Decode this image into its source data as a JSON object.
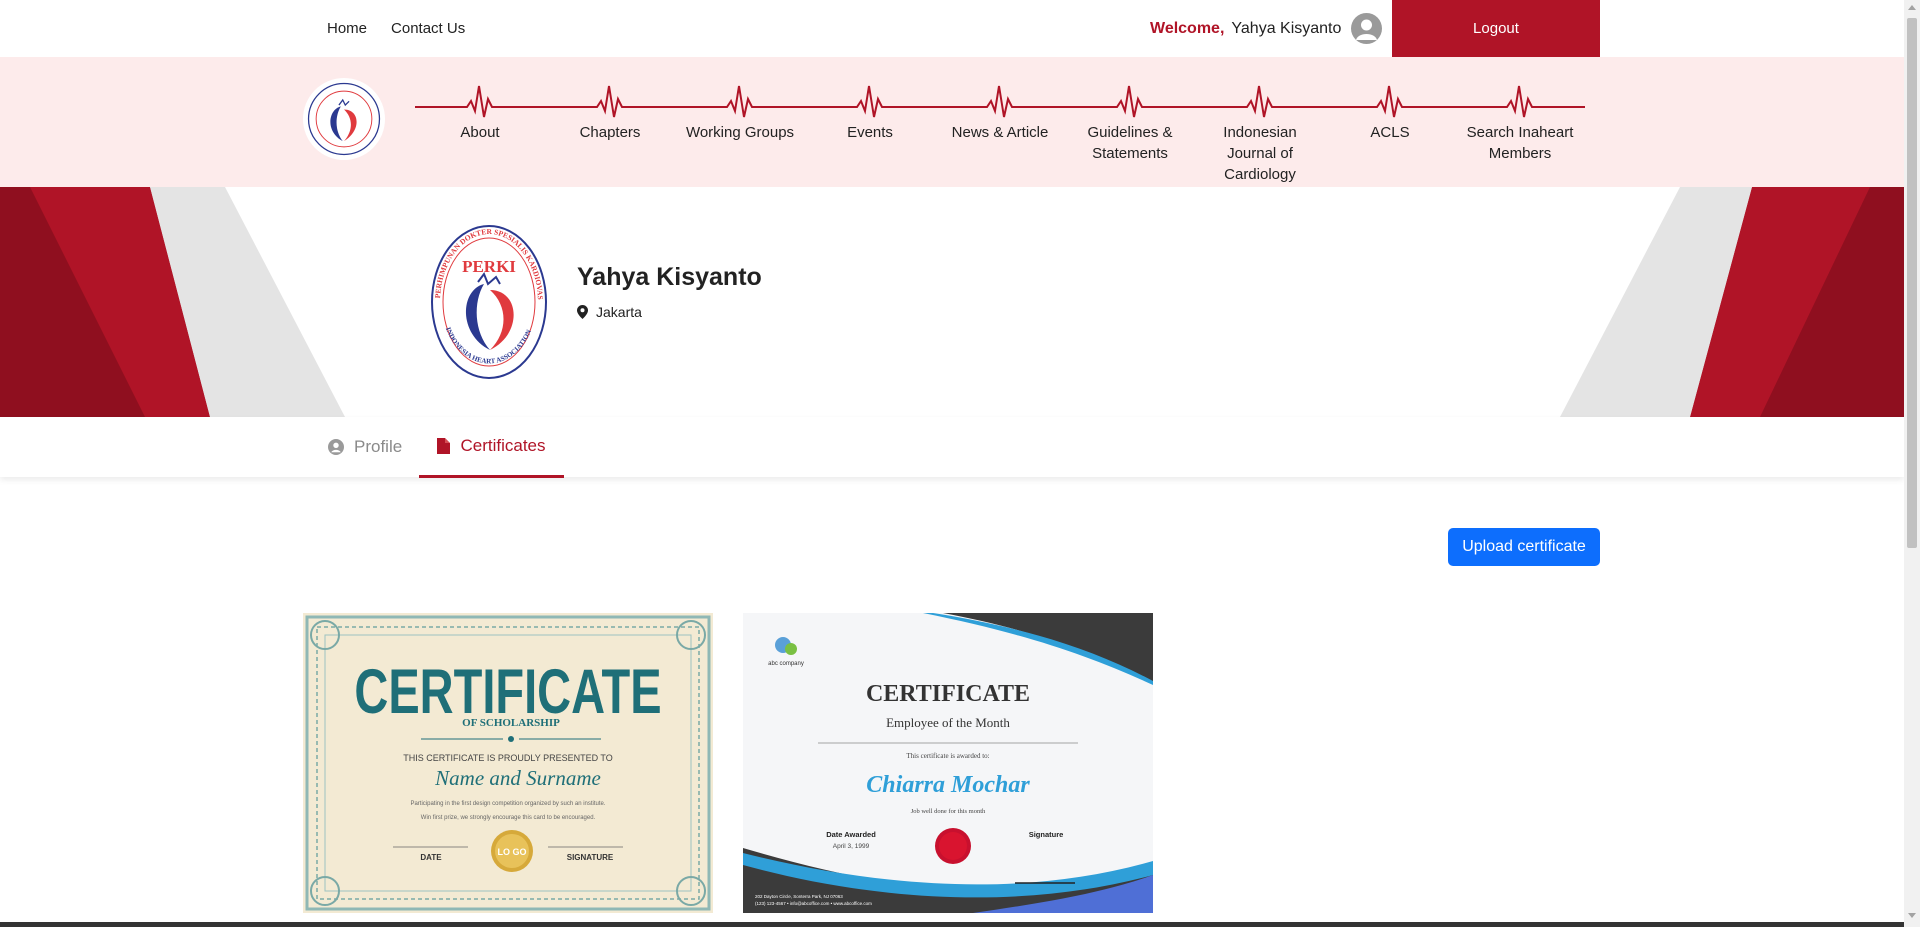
{
  "topbar": {
    "links": [
      "Home",
      "Contact Us"
    ],
    "welcome_label": "Welcome,",
    "user_name": "Yahya Kisyanto",
    "logout_label": "Logout"
  },
  "mainnav": {
    "items": [
      {
        "line1": "About",
        "line2": ""
      },
      {
        "line1": "Chapters",
        "line2": ""
      },
      {
        "line1": "Working Groups",
        "line2": ""
      },
      {
        "line1": "Events",
        "line2": ""
      },
      {
        "line1": "News & Article",
        "line2": ""
      },
      {
        "line1": "Guidelines &",
        "line2": "Statements"
      },
      {
        "line1": "Indonesian",
        "line2": "Journal of Cardiology"
      },
      {
        "line1": "ACLS",
        "line2": ""
      },
      {
        "line1": "Search Inaheart",
        "line2": "Members"
      }
    ]
  },
  "logo": {
    "text": "PERKI",
    "ring_text": "PERHIMPUNAN DOKTER SPESIALIS KARDIOVASKULAR INDONESIA",
    "bottom_text": "INDONESIA HEART ASSOCIATION"
  },
  "profile": {
    "name": "Yahya Kisyanto",
    "location": "Jakarta"
  },
  "tabs": {
    "profile_label": "Profile",
    "certificates_label": "Certificates"
  },
  "content": {
    "upload_label": "Upload certificate"
  },
  "certificates": [
    {
      "title": "CERTIFICATE",
      "subtitle": "OF SCHOLARSHIP",
      "presented": "THIS CERTIFICATE IS PROUDLY PRESENTED TO",
      "name": "Name and Surname",
      "line1": "Participating in the first design competition organized by such an institute.",
      "line2": "Win first prize, we strongly encourage this card to be encouraged.",
      "date_label": "DATE",
      "seal_text": "LO GO",
      "signature_label": "SIGNATURE"
    },
    {
      "company": "abc company",
      "title": "CERTIFICATE",
      "subtitle": "Employee of the Month",
      "awarded": "This certificate is awarded to:",
      "name": "Chiarra Mochar",
      "note": "Job well done for this month",
      "date_label": "Date Awarded",
      "date_value": "April 3, 1999",
      "signature_label": "Signature",
      "footer1": "202 Dayton Circle, Sonterra Park, NJ 07063",
      "footer2": "(123) 123-4567 • info@abcoffice.com • www.abcoffice.com"
    }
  ],
  "colors": {
    "brand_red": "#b01427",
    "nav_bg": "#fdebeb",
    "primary_blue": "#0d6efd"
  }
}
